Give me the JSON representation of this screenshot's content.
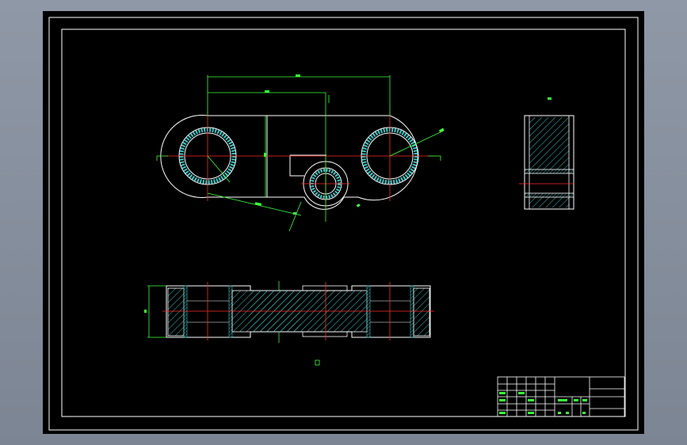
{
  "colors": {
    "background": "#000000",
    "outline": "#ffffff",
    "dimension": "#3cff3c",
    "centerline": "#ff2a2a",
    "hatch": "#39c8c8"
  },
  "top_view": {
    "dims": {
      "overall": "",
      "partial": "",
      "radius": "",
      "angle": "",
      "small": ""
    }
  },
  "side_view": {
    "label": "",
    "section_marks": [
      "",
      ""
    ]
  },
  "front_section": {
    "label": "",
    "height_dim": ""
  },
  "title_block": {
    "rows": 5
  }
}
